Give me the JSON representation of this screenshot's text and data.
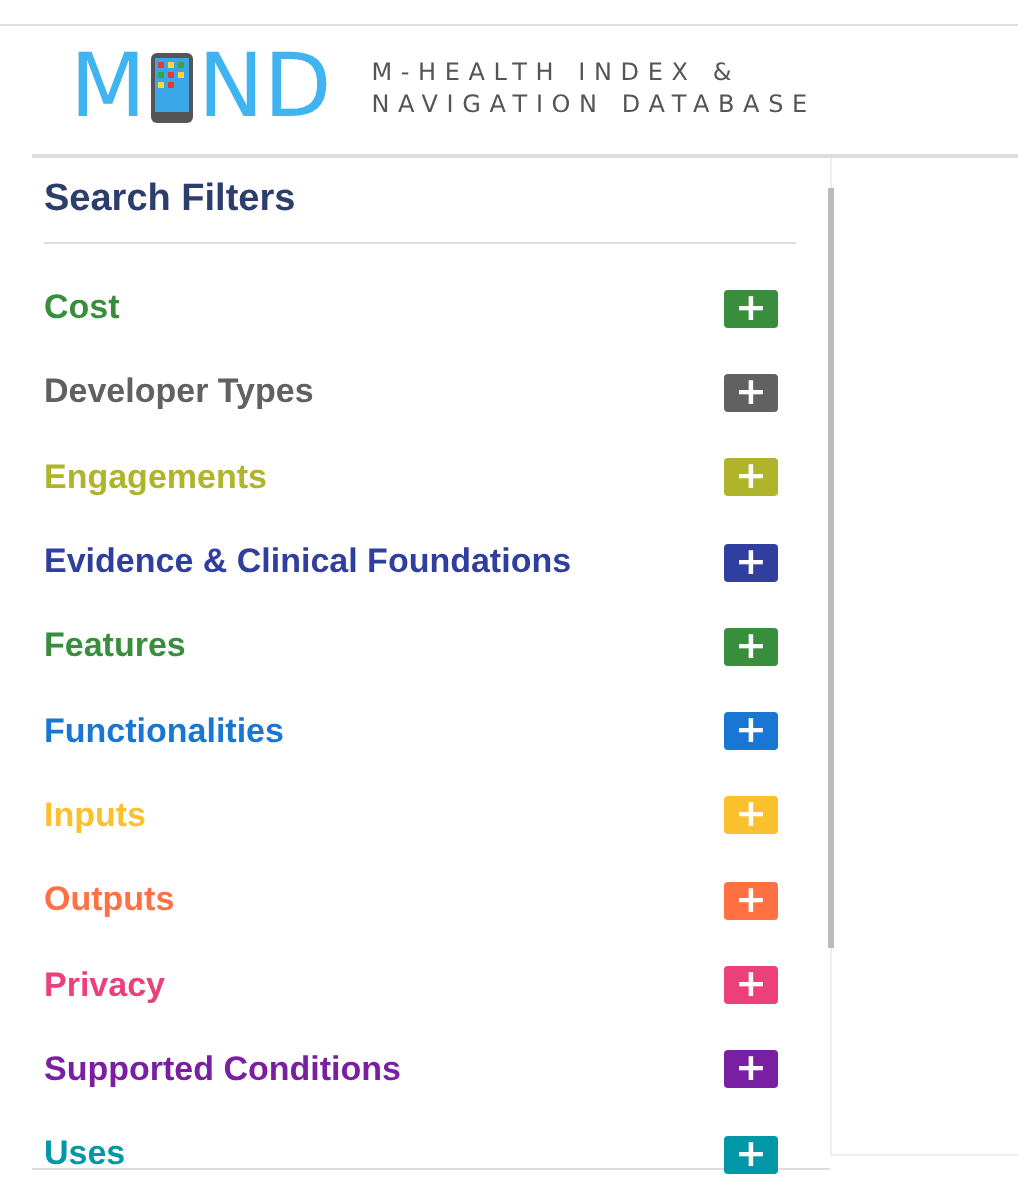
{
  "header": {
    "logo_start": "M",
    "logo_end": "ND",
    "tagline": [
      "M-HEALTH INDEX &",
      "NAVIGATION DATABASE"
    ]
  },
  "filters": {
    "title": "Search Filters",
    "items": [
      {
        "label": "Cost",
        "color": "#388e3c",
        "button": "+"
      },
      {
        "label": "Developer Types",
        "color": "#616161",
        "button": "+"
      },
      {
        "label": "Engagements",
        "color": "#afb42b",
        "button": "+"
      },
      {
        "label": "Evidence & Clinical Foundations",
        "color": "#303f9f",
        "button": "+"
      },
      {
        "label": "Features",
        "color": "#388e3c",
        "button": "+"
      },
      {
        "label": "Functionalities",
        "color": "#1976d2",
        "button": "+"
      },
      {
        "label": "Inputs",
        "color": "#fbc02d",
        "button": "+"
      },
      {
        "label": "Outputs",
        "color": "#ff7043",
        "button": "+"
      },
      {
        "label": "Privacy",
        "color": "#ec407a",
        "button": "+"
      },
      {
        "label": "Supported Conditions",
        "color": "#7b1fa2",
        "button": "+"
      },
      {
        "label": "Uses",
        "color": "#0097a7",
        "button": "+"
      }
    ]
  }
}
